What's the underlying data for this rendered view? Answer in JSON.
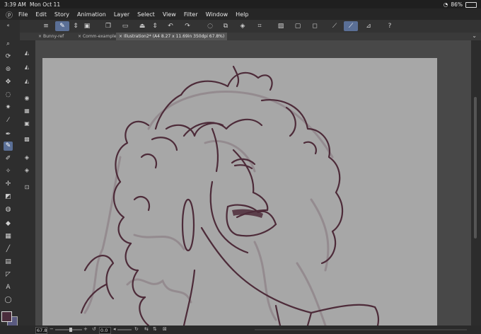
{
  "status_bar": {
    "time": "3:39 AM",
    "date": "Mon Oct 11",
    "battery": "86%"
  },
  "menu": {
    "items": [
      "File",
      "Edit",
      "Story",
      "Animation",
      "Layer",
      "Select",
      "View",
      "Filter",
      "Window",
      "Help"
    ]
  },
  "toolbar": {
    "icons": [
      "menu-icon",
      "pen-tool-icon",
      "chevron-up-down-icon",
      "camera-icon",
      "new-file-icon",
      "open-folder-icon",
      "save-icon",
      "chevron-up-down-icon",
      "undo-icon",
      "redo-icon",
      "lasso-icon",
      "transform-icon",
      "clear-icon",
      "fill-icon",
      "crop-icon",
      "select-all-icon",
      "deselect-icon",
      "invert-icon",
      "ruler-icon",
      "brush-icon",
      "stabilizer-icon",
      "help-icon"
    ]
  },
  "tabs": [
    {
      "label": "Bunny-ref",
      "close": "×"
    },
    {
      "label": "Comm-example",
      "close": "×"
    },
    {
      "label": "Illustration2* (A4 8.27 x 11.69in 350dpi 67.8%)",
      "close": "×"
    }
  ],
  "bottom": {
    "zoom": "67.8",
    "rotation": "0.0",
    "zoom_minus": "−",
    "zoom_plus": "+"
  },
  "colors": {
    "main": "#4a2d3c",
    "sub": "#5a5a80",
    "accent": "#5a6f96",
    "canvas": "#a7a7a7",
    "line": "#4d2b39"
  }
}
